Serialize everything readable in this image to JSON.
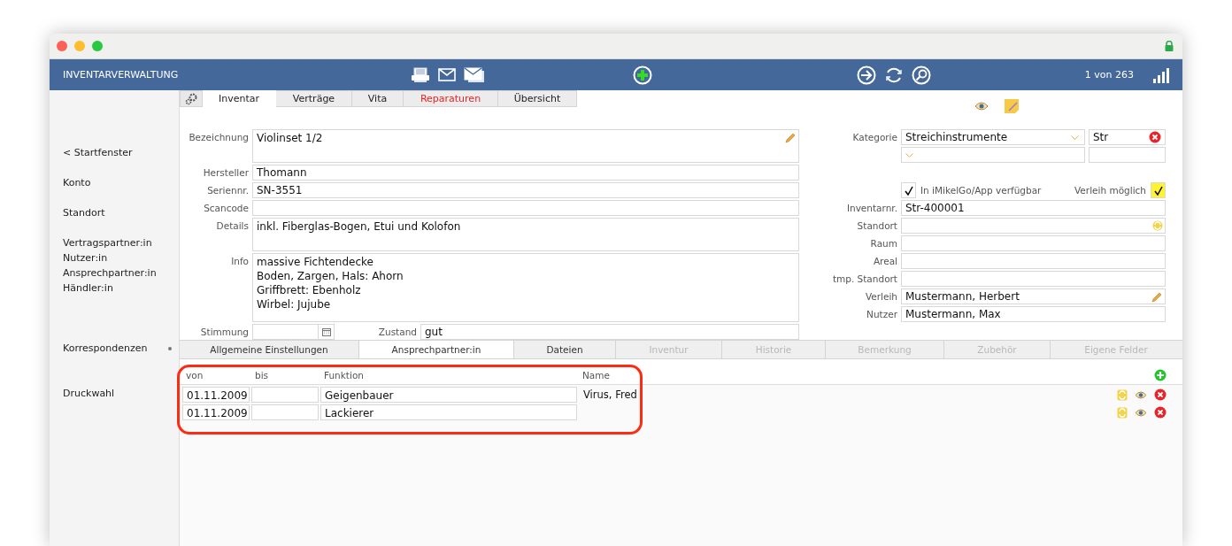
{
  "header": {
    "title": "INVENTARVERWALTUNG",
    "counter": "1 von 263"
  },
  "sidebar": {
    "groups": [
      [
        {
          "label": "< Startfenster",
          "indicator": false
        }
      ],
      [
        {
          "label": "Konto",
          "indicator": false
        }
      ],
      [
        {
          "label": "Standort",
          "indicator": false
        }
      ],
      [
        {
          "label": "Vertragspartner:in",
          "indicator": false
        },
        {
          "label": "Nutzer:in",
          "indicator": false
        },
        {
          "label": "Ansprechpartner:in",
          "indicator": false
        },
        {
          "label": "Händler:in",
          "indicator": false
        }
      ],
      [
        {
          "label": "Korrespondenzen",
          "indicator": true
        }
      ],
      [
        {
          "label": "Druckwahl",
          "indicator": false
        }
      ]
    ]
  },
  "tabs": [
    {
      "label": "Inventar",
      "selected": true,
      "alert": false
    },
    {
      "label": "Verträge",
      "selected": false,
      "alert": false
    },
    {
      "label": "Vita",
      "selected": false,
      "alert": false
    },
    {
      "label": "Reparaturen",
      "selected": false,
      "alert": true
    },
    {
      "label": "Übersicht",
      "selected": false,
      "alert": false
    }
  ],
  "form_left": [
    {
      "label": "Bezeichnung",
      "value": "Violinset 1/2",
      "kind": "tall",
      "editable": true
    },
    {
      "label": "Hersteller",
      "value": "Thomann",
      "kind": "line"
    },
    {
      "label": "Seriennr.",
      "value": "SN-3551",
      "kind": "line"
    },
    {
      "label": "Scancode",
      "kind": "line"
    },
    {
      "label": "Details",
      "value": "inkl. Fiberglas-Bogen, Etui und Kolofon",
      "kind": "tall"
    },
    {
      "label": "Info",
      "value": "massive Fichtendecke\nBoden, Zargen, Hals: Ahorn\nGriffbrett: Ebenholz\nWirbel: Jujube",
      "kind": "area"
    }
  ],
  "stimmung": {
    "label": "Stimmung"
  },
  "zustand": {
    "label": "Zustand",
    "value": "gut"
  },
  "kategorie": {
    "label": "Kategorie",
    "value": "Streichinstrumente",
    "code": "Str"
  },
  "app_available": {
    "label": "In iMikelGo/App verfügbar",
    "checked": true
  },
  "lending_possible": {
    "label": "Verleih möglich",
    "checked": true
  },
  "form_right": [
    {
      "label": "Inventarnr.",
      "value": "Str-400001",
      "kind": "plain"
    },
    {
      "label": "Standort",
      "kind": "refresh"
    },
    {
      "label": "Raum",
      "kind": "plain"
    },
    {
      "label": "Areal",
      "kind": "plain"
    },
    {
      "label": "tmp. Standort",
      "kind": "plain"
    },
    {
      "label": "Verleih",
      "value": "Mustermann, Herbert",
      "kind": "edit"
    },
    {
      "label": "Nutzer",
      "value": "Mustermann, Max",
      "kind": "plain"
    }
  ],
  "subtabs": [
    {
      "label": "Allgemeine Einstellungen",
      "selected": false,
      "disabled": false
    },
    {
      "label": "Ansprechpartner:in",
      "selected": true,
      "disabled": false
    },
    {
      "label": "Dateien",
      "selected": false,
      "disabled": false
    },
    {
      "label": "Inventur",
      "selected": false,
      "disabled": true
    },
    {
      "label": "Historie",
      "selected": false,
      "disabled": true
    },
    {
      "label": "Bemerkung",
      "selected": false,
      "disabled": true
    },
    {
      "label": "Zubehör",
      "selected": false,
      "disabled": true
    },
    {
      "label": "Eigene Felder",
      "selected": false,
      "disabled": true
    }
  ],
  "contacts": {
    "highlighted": true,
    "columns": [
      "von",
      "bis",
      "Funktion",
      "Name"
    ],
    "rows": [
      {
        "von": "01.11.2009",
        "funktion": "Geigenbauer",
        "name": "Virus, Fred"
      },
      {
        "von": "01.11.2009",
        "funktion": "Lackierer"
      }
    ]
  }
}
